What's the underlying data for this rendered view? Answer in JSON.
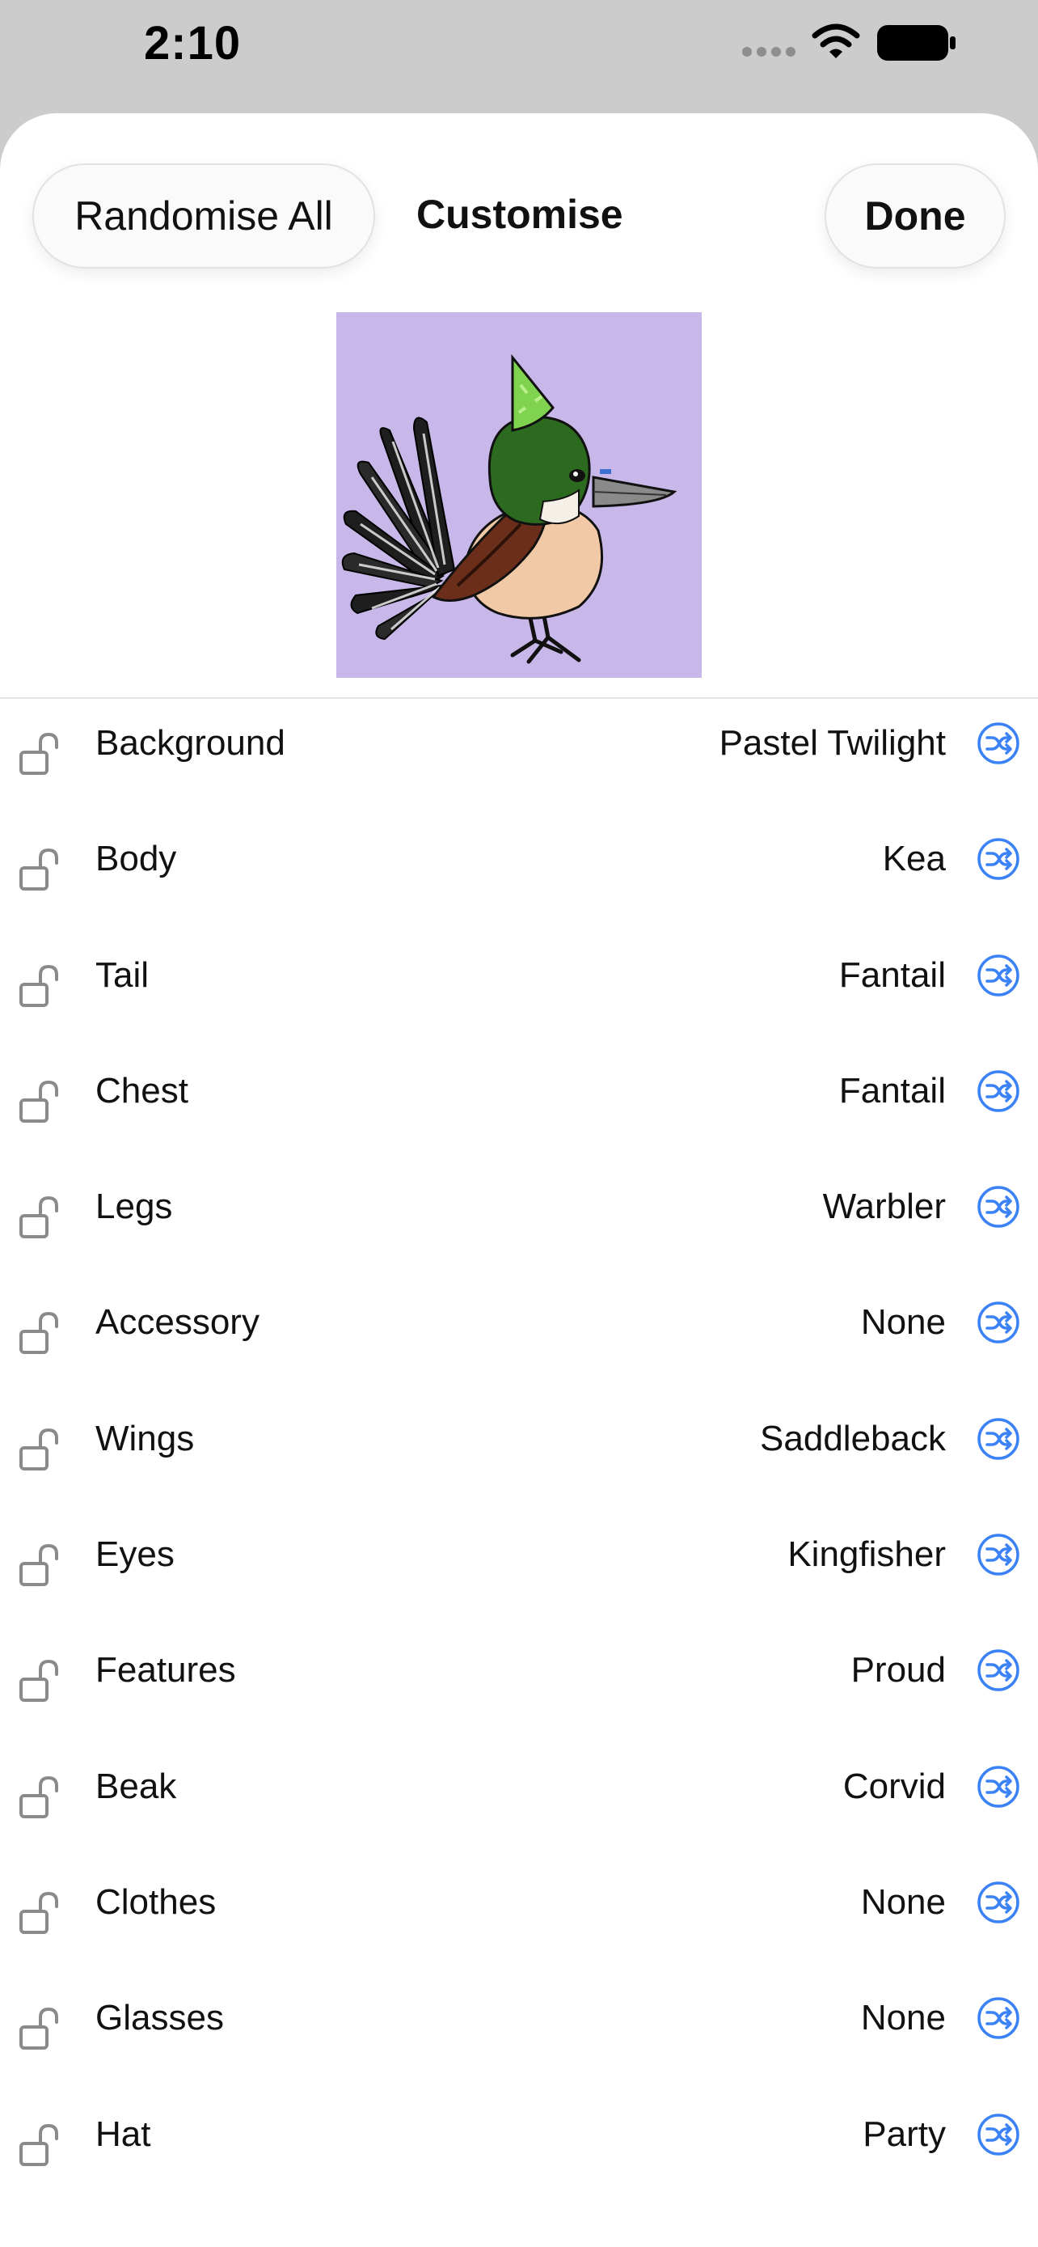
{
  "status_bar": {
    "time": "2:10"
  },
  "header": {
    "randomise_label": "Randomise All",
    "title": "Customise",
    "done_label": "Done"
  },
  "preview": {
    "background_color": "#c8b8e9"
  },
  "options": [
    {
      "label": "Background",
      "value": "Pastel Twilight"
    },
    {
      "label": "Body",
      "value": "Kea"
    },
    {
      "label": "Tail",
      "value": "Fantail"
    },
    {
      "label": "Chest",
      "value": "Fantail"
    },
    {
      "label": "Legs",
      "value": "Warbler"
    },
    {
      "label": "Accessory",
      "value": "None"
    },
    {
      "label": "Wings",
      "value": "Saddleback"
    },
    {
      "label": "Eyes",
      "value": "Kingfisher"
    },
    {
      "label": "Features",
      "value": "Proud"
    },
    {
      "label": "Beak",
      "value": "Corvid"
    },
    {
      "label": "Clothes",
      "value": "None"
    },
    {
      "label": "Glasses",
      "value": "None"
    },
    {
      "label": "Hat",
      "value": "Party"
    }
  ],
  "icons": {
    "lock": "lock-open-icon",
    "shuffle": "shuffle-icon"
  },
  "colors": {
    "accent": "#3b82f6",
    "lock_gray": "#8a8a8a"
  }
}
